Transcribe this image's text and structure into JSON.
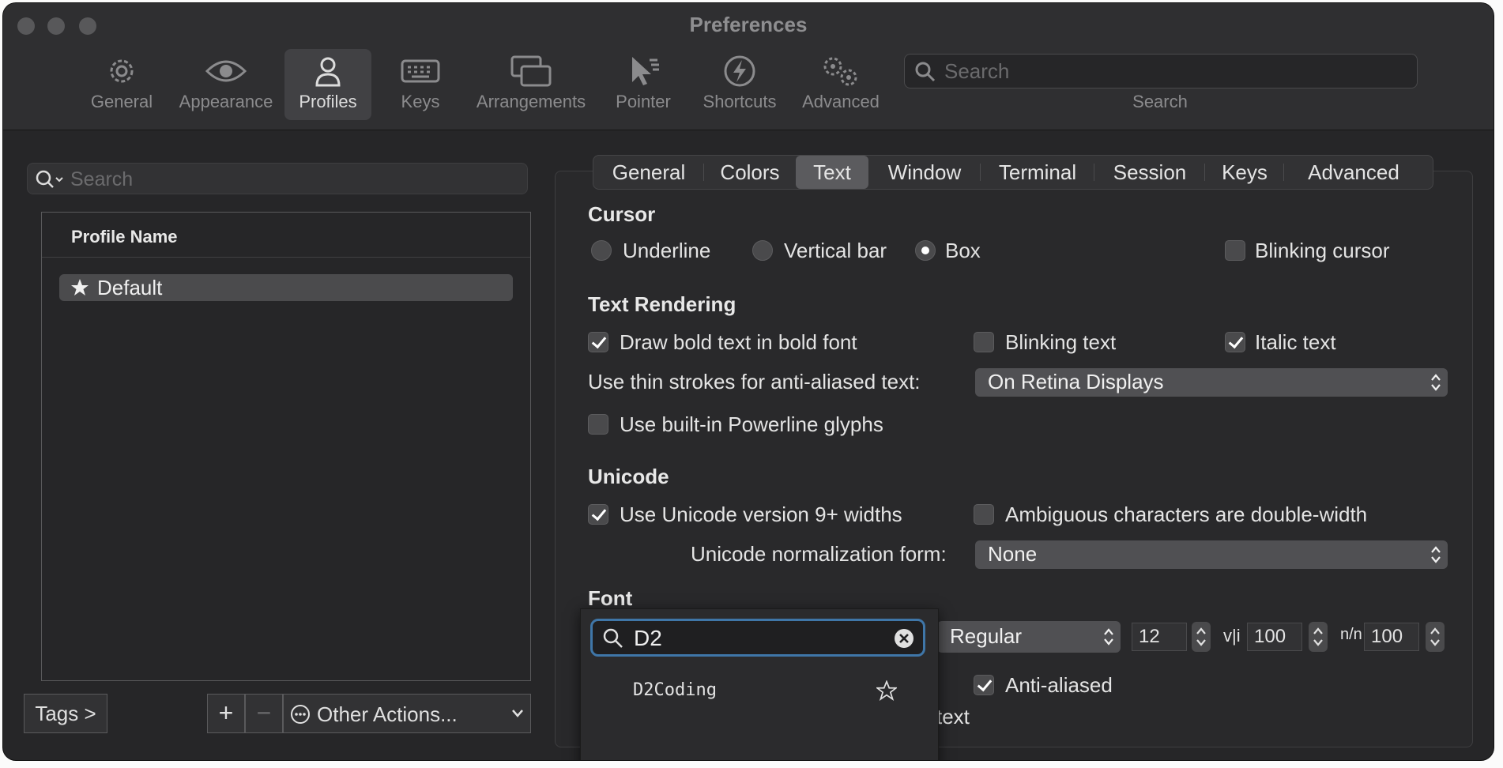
{
  "window": {
    "title": "Preferences"
  },
  "toolbar": {
    "items": [
      {
        "label": "General",
        "icon": "gear-icon"
      },
      {
        "label": "Appearance",
        "icon": "eye-icon"
      },
      {
        "label": "Profiles",
        "icon": "person-icon",
        "active": true
      },
      {
        "label": "Keys",
        "icon": "keyboard-icon"
      },
      {
        "label": "Arrangements",
        "icon": "windows-icon"
      },
      {
        "label": "Pointer",
        "icon": "pointer-icon"
      },
      {
        "label": "Shortcuts",
        "icon": "lightning-icon"
      },
      {
        "label": "Advanced",
        "icon": "gears-icon"
      }
    ],
    "search": {
      "placeholder": "Search",
      "caption": "Search"
    }
  },
  "profiles": {
    "search_placeholder": "Search",
    "column_header": "Profile Name",
    "rows": [
      {
        "name": "Default",
        "icon": "star-icon"
      }
    ],
    "tags_button": "Tags >",
    "add_label": "+",
    "remove_label": "−",
    "other_actions": "Other Actions..."
  },
  "tabs": [
    "General",
    "Colors",
    "Text",
    "Window",
    "Terminal",
    "Session",
    "Keys",
    "Advanced"
  ],
  "active_tab": "Text",
  "cursor": {
    "heading": "Cursor",
    "options": [
      "Underline",
      "Vertical bar",
      "Box"
    ],
    "selected": "Box",
    "blinking_label": "Blinking cursor",
    "blinking": false
  },
  "rendering": {
    "heading": "Text Rendering",
    "bold_label": "Draw bold text in bold font",
    "bold": true,
    "blink_label": "Blinking text",
    "blink": false,
    "italic_label": "Italic text",
    "italic": true,
    "thin_label": "Use thin strokes for anti-aliased text:",
    "thin_value": "On Retina Displays",
    "powerline_label": "Use built-in Powerline glyphs",
    "powerline": false
  },
  "unicode": {
    "heading": "Unicode",
    "v9_label": "Use Unicode version 9+ widths",
    "v9": true,
    "ambiguous_label": "Ambiguous characters are double-width",
    "ambiguous": false,
    "norm_label": "Unicode normalization form:",
    "norm_value": "None"
  },
  "font": {
    "heading": "Font",
    "weight": "Regular",
    "size": "12",
    "h_spacing_symbol": "v|i",
    "h_spacing": "100",
    "v_spacing_symbol": "n/n",
    "v_spacing": "100",
    "antialiased_label": "Anti-aliased",
    "antialiased": true,
    "partial_label": "l text"
  },
  "font_popup": {
    "search_value": "D2",
    "results": [
      "D2Coding"
    ]
  }
}
